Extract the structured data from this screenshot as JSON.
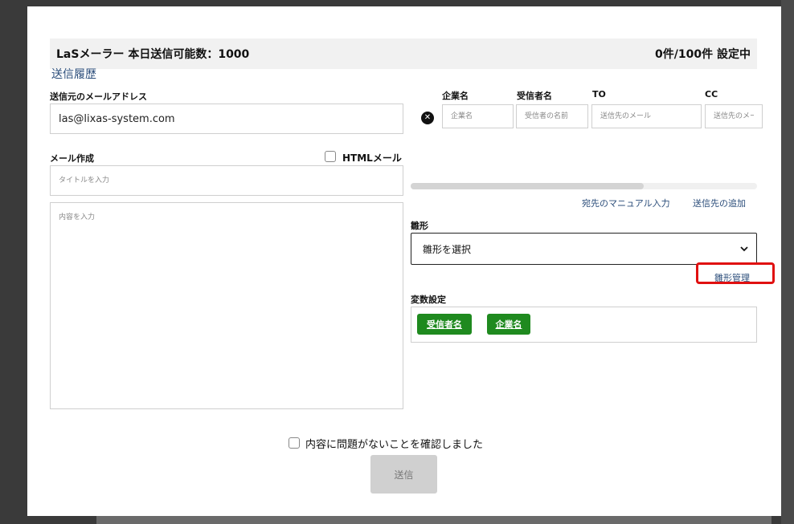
{
  "header": {
    "title": "LaSメーラー 本日送信可能数：1000",
    "count_status": "0件/100件 設定中"
  },
  "history_link": "送信履歴",
  "sender": {
    "label": "送信元のメールアドレス",
    "value": "las@lixas-system.com"
  },
  "compose": {
    "label": "メール作成",
    "html_mail_label": "HTMLメール",
    "title_placeholder": "タイトルを入力",
    "body_placeholder": "内容を入力"
  },
  "recipients": {
    "columns": [
      "企業名",
      "受信者名",
      "TO",
      "CC"
    ],
    "placeholders": [
      "企業名",
      "受信者の名前",
      "送信先のメール",
      "送信先のメー"
    ],
    "manual_input_link": "宛先のマニュアル入力",
    "add_recipient_link": "送信先の追加"
  },
  "template": {
    "label": "雛形",
    "select_value": "雛形を選択",
    "manage_link": "雛形管理"
  },
  "variables": {
    "label": "変数設定",
    "tags": [
      "受信者名",
      "企業名"
    ]
  },
  "confirm_label": "内容に問題がないことを確認しました",
  "send_label": "送信",
  "colors": {
    "tag_green": "#1f8a1f",
    "highlight_red": "#e01010",
    "link_blue": "#2b4d7a"
  }
}
